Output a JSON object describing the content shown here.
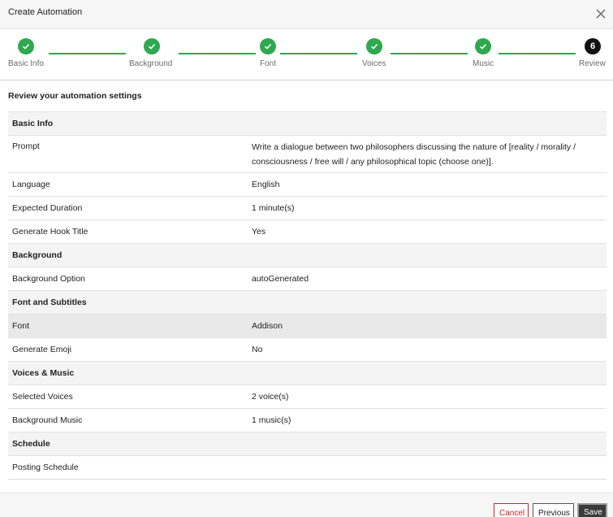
{
  "dialog": {
    "title": "Create Automation"
  },
  "stepper": {
    "steps": [
      {
        "label": "Basic Info",
        "state": "done"
      },
      {
        "label": "Background",
        "state": "done"
      },
      {
        "label": "Font",
        "state": "done"
      },
      {
        "label": "Voices",
        "state": "done"
      },
      {
        "label": "Music",
        "state": "done"
      },
      {
        "label": "Review",
        "state": "active",
        "number": "6"
      }
    ]
  },
  "review": {
    "heading": "Review your automation settings",
    "groups": {
      "basic": {
        "title": "Basic Info",
        "prompt_key": "Prompt",
        "prompt_val": "Write a dialogue between two philosophers discussing the nature of [reality / morality / consciousness / free will / any philosophical topic (choose one)].",
        "language_key": "Language",
        "language_val": "English",
        "duration_key": "Expected Duration",
        "duration_val": "1 minute(s)",
        "hook_key": "Generate Hook Title",
        "hook_val": "Yes"
      },
      "background": {
        "title": "Background",
        "option_key": "Background Option",
        "option_val": "autoGenerated"
      },
      "font": {
        "title": "Font and Subtitles",
        "font_key": "Font",
        "font_val": "Addison",
        "emoji_key": "Generate Emoji",
        "emoji_val": "No"
      },
      "voices": {
        "title": "Voices & Music",
        "voices_key": "Selected Voices",
        "voices_val": "2 voice(s)",
        "music_key": "Background Music",
        "music_val": "1 music(s)"
      },
      "schedule": {
        "title": "Schedule",
        "posting_key": "Posting Schedule",
        "posting_val": ""
      }
    }
  },
  "footer": {
    "cancel_label": "Cancel",
    "previous_label": "Previous",
    "save_label": "Save"
  },
  "colors": {
    "step_done": "#2fa84f",
    "step_active": "#111111",
    "cancel": "#c8242b"
  },
  "icons": {
    "close": "close-icon",
    "done": "check-icon"
  }
}
